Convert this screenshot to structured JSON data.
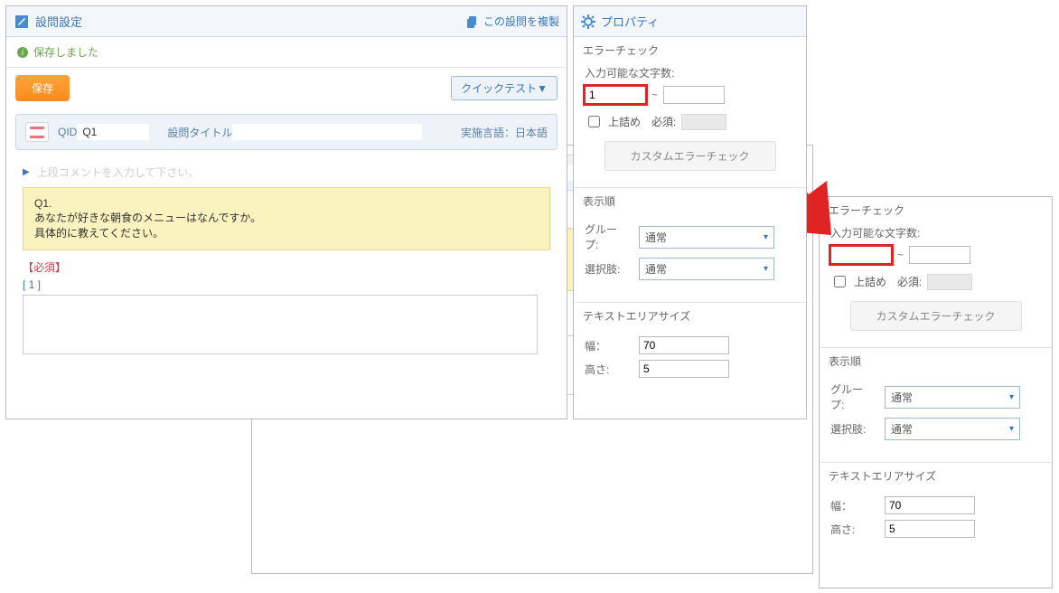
{
  "main": {
    "header_title": "設問設定",
    "copy_label": "この設問を複製",
    "saved_msg": "保存しました",
    "save_btn": "保存",
    "quicktest_btn": "クイックテスト▼",
    "qid_label": "QID",
    "qid_value": "Q1",
    "title_label": "設問タイトル",
    "title_value": "",
    "lang_label": "実施言語：",
    "lang_value": "日本語",
    "top_comment_hint": "上段コメントを入力して下さい。",
    "q_number": "Q1.",
    "q_line1": "あなたが好きな朝食のメニューはなんですか。",
    "q_line2": "具体的に教えてください。",
    "q_line2_back": "具体的に教えてください。",
    "required_label": "【必須】",
    "bracket_number": "[ 1 ]"
  },
  "prop": {
    "header_title": "プロパティ",
    "err_check": "エラーチェック",
    "char_limit_label": "入力可能な文字数:",
    "char_min_front": "1",
    "char_max_front": "",
    "char_min_back": "",
    "char_max_back": "",
    "top_align": "上詰め",
    "req_label": "必須:",
    "custom_err_btn": "カスタムエラーチェック",
    "display_order": "表示順",
    "group_label": "グループ:",
    "group_value": "通常",
    "choice_label": "選択肢:",
    "choice_value": "通常",
    "textarea_size": "テキストエリアサイズ",
    "width_label": "幅：",
    "width_value": "70",
    "height_label": "高さ:",
    "height_value": "5"
  }
}
